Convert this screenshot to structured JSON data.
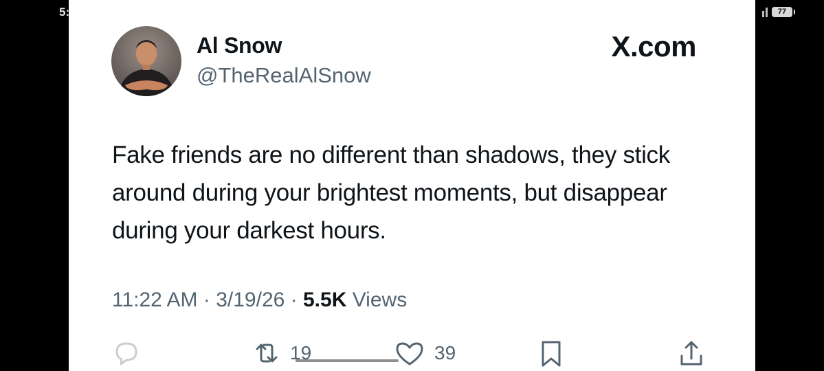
{
  "status_bar": {
    "time_fragment": "5:",
    "battery_level": "77"
  },
  "tweet": {
    "display_name": "Al Snow",
    "handle": "@TheRealAlSnow",
    "brand": "X.com",
    "text": "Fake friends are no different than shadows, they stick around during your brightest moments, but disappear during your darkest hours.",
    "time": "11:22 AM",
    "separator": "·",
    "date": "3/19/26",
    "views_count": "5.5K",
    "views_label": "Views",
    "actions": {
      "reply_icon": "speech-bubble-icon",
      "repost_icon": "repost-arrows-icon",
      "repost_count": "19",
      "like_icon": "heart-outline-icon",
      "like_count": "39",
      "bookmark_icon": "bookmark-icon",
      "share_icon": "share-upload-icon"
    }
  },
  "colors": {
    "text_primary": "#0f1419",
    "text_secondary": "#536471",
    "background": "#ffffff",
    "frame": "#000000"
  }
}
